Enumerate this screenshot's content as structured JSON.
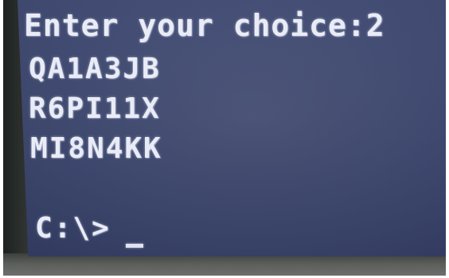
{
  "console": {
    "prompt": "Enter your choice:2",
    "codes": [
      "QA1A3JB",
      "R6PI11X",
      "MI8N4KK"
    ],
    "command_prompt": "C:\\>"
  },
  "colors": {
    "screen_background": "#3e4870",
    "text": "#e9ecf6",
    "bezel": "#2f3331"
  }
}
